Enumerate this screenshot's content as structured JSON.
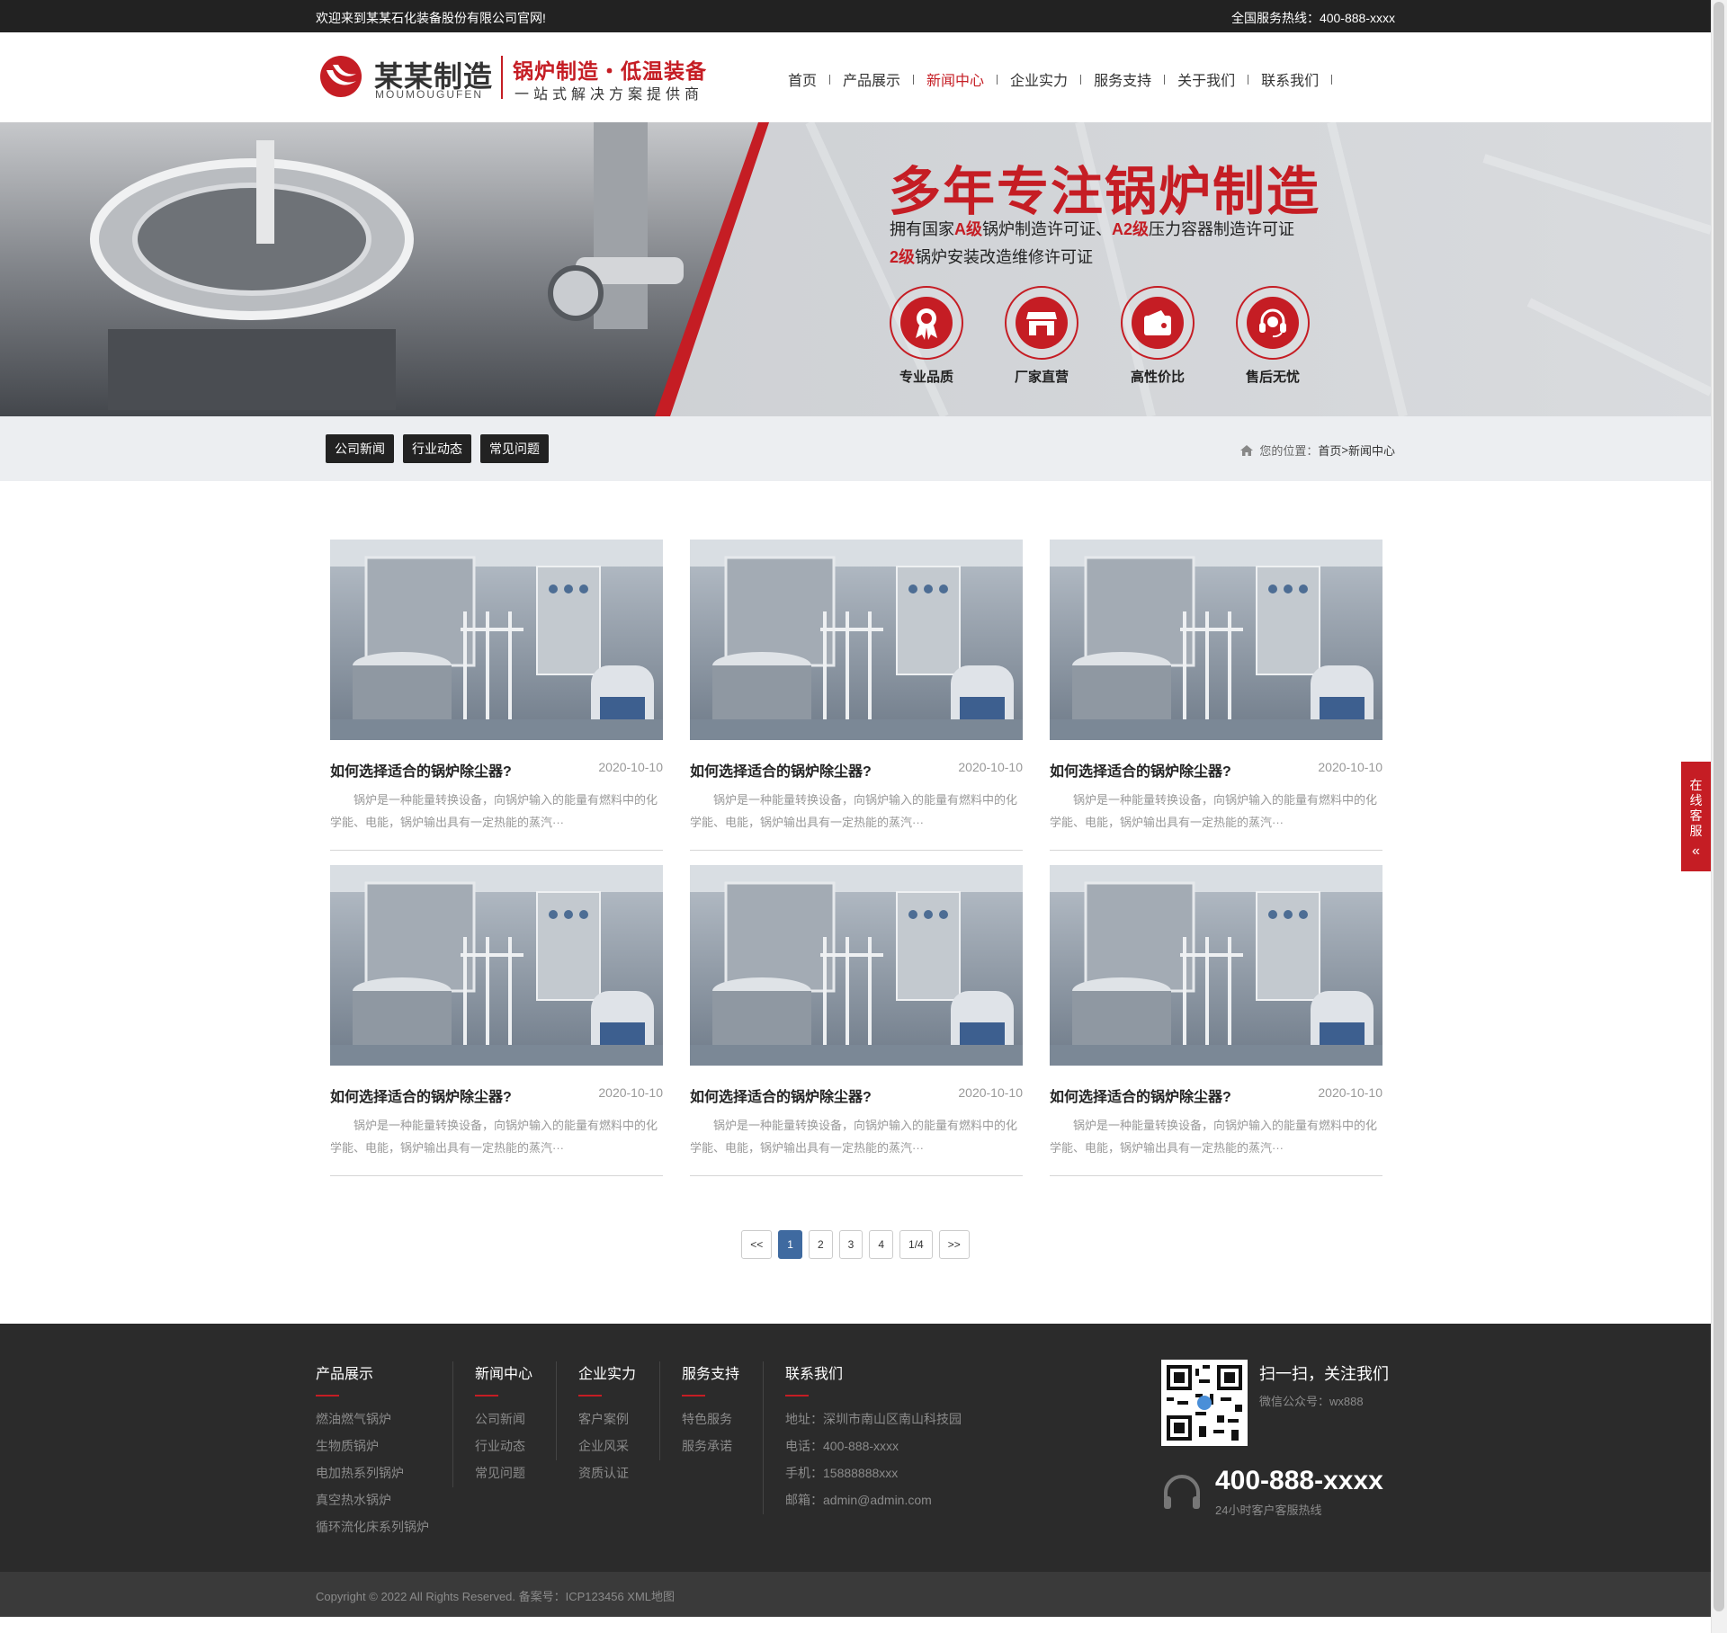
{
  "topbar": {
    "welcome": "欢迎来到某某石化装备股份有限公司官网!",
    "hotline": "全国服务热线：400-888-xxxx"
  },
  "header": {
    "logo_cn": "某某制造",
    "logo_en": "MOUMOUGUFEN",
    "slogan_main": "锅炉制造・低温装备",
    "slogan_sub": "一站式解决方案提供商",
    "brand_color": "#c51d24"
  },
  "nav": {
    "items": [
      {
        "label": "首页"
      },
      {
        "label": "产品展示"
      },
      {
        "label": "新闻中心",
        "active": true
      },
      {
        "label": "企业实力"
      },
      {
        "label": "服务支持"
      },
      {
        "label": "关于我们"
      },
      {
        "label": "联系我们"
      }
    ]
  },
  "banner": {
    "title": "多年专注锅炉制造",
    "line1_a": "拥有国家",
    "line1_b": "A级",
    "line1_c": "锅炉制造许可证、",
    "line1_d": "A2级",
    "line1_e": "压力容器制造许可证",
    "line2_a": "2级",
    "line2_b": "锅炉安装改造维修许可证",
    "features": [
      {
        "label": "专业品质",
        "icon": "award-ribbon-icon"
      },
      {
        "label": "厂家直营",
        "icon": "storefront-icon"
      },
      {
        "label": "高性价比",
        "icon": "wallet-icon"
      },
      {
        "label": "售后无忧",
        "icon": "headset-icon"
      }
    ]
  },
  "subnav": {
    "tabs": [
      {
        "label": "公司新闻"
      },
      {
        "label": "行业动态"
      },
      {
        "label": "常见问题"
      }
    ],
    "crumb_prefix": "您的位置：",
    "crumb_home": "首页",
    "crumb_sep": ">",
    "crumb_current": "新闻中心"
  },
  "news": {
    "items": [
      {
        "title": "如何选择适合的锅炉除尘器?",
        "date": "2020-10-10",
        "desc": "锅炉是一种能量转换设备，向锅炉输入的能量有燃料中的化学能、电能，锅炉输出具有一定热能的蒸汽···"
      },
      {
        "title": "如何选择适合的锅炉除尘器?",
        "date": "2020-10-10",
        "desc": "锅炉是一种能量转换设备，向锅炉输入的能量有燃料中的化学能、电能，锅炉输出具有一定热能的蒸汽···"
      },
      {
        "title": "如何选择适合的锅炉除尘器?",
        "date": "2020-10-10",
        "desc": "锅炉是一种能量转换设备，向锅炉输入的能量有燃料中的化学能、电能，锅炉输出具有一定热能的蒸汽···"
      },
      {
        "title": "如何选择适合的锅炉除尘器?",
        "date": "2020-10-10",
        "desc": "锅炉是一种能量转换设备，向锅炉输入的能量有燃料中的化学能、电能，锅炉输出具有一定热能的蒸汽···"
      },
      {
        "title": "如何选择适合的锅炉除尘器?",
        "date": "2020-10-10",
        "desc": "锅炉是一种能量转换设备，向锅炉输入的能量有燃料中的化学能、电能，锅炉输出具有一定热能的蒸汽···"
      },
      {
        "title": "如何选择适合的锅炉除尘器?",
        "date": "2020-10-10",
        "desc": "锅炉是一种能量转换设备，向锅炉输入的能量有燃料中的化学能、电能，锅炉输出具有一定热能的蒸汽···"
      }
    ]
  },
  "pager": {
    "prev": "<<",
    "pages": [
      "1",
      "2",
      "3",
      "4"
    ],
    "current": "1",
    "summary": "1/4",
    "next": ">>"
  },
  "side_service": {
    "chars": [
      "在",
      "线",
      "客",
      "服"
    ],
    "arrow": "«"
  },
  "footer": {
    "columns": [
      {
        "heading": "产品展示",
        "links": [
          "燃油燃气锅炉",
          "生物质锅炉",
          "电加热系列锅炉",
          "真空热水锅炉",
          "循环流化床系列锅炉"
        ]
      },
      {
        "heading": "新闻中心",
        "links": [
          "公司新闻",
          "行业动态",
          "常见问题"
        ]
      },
      {
        "heading": "企业实力",
        "links": [
          "客户案例",
          "企业风采",
          "资质认证"
        ]
      },
      {
        "heading": "服务支持",
        "links": [
          "特色服务",
          "服务承诺"
        ]
      },
      {
        "heading": "联系我们",
        "links": [
          "地址：深圳市南山区南山科技园",
          "电话：400-888-xxxx",
          "手机：15888888xxx",
          "邮箱：admin@admin.com"
        ]
      }
    ],
    "scan_title": "扫一扫，关注我们",
    "wechat": "微信公众号：wx888",
    "big_phone": "400-888-xxxx",
    "hours": "24小时客户客服热线"
  },
  "copyright": "Copyright © 2022 All Rights Reserved. 备案号：ICP123456 XML地图"
}
